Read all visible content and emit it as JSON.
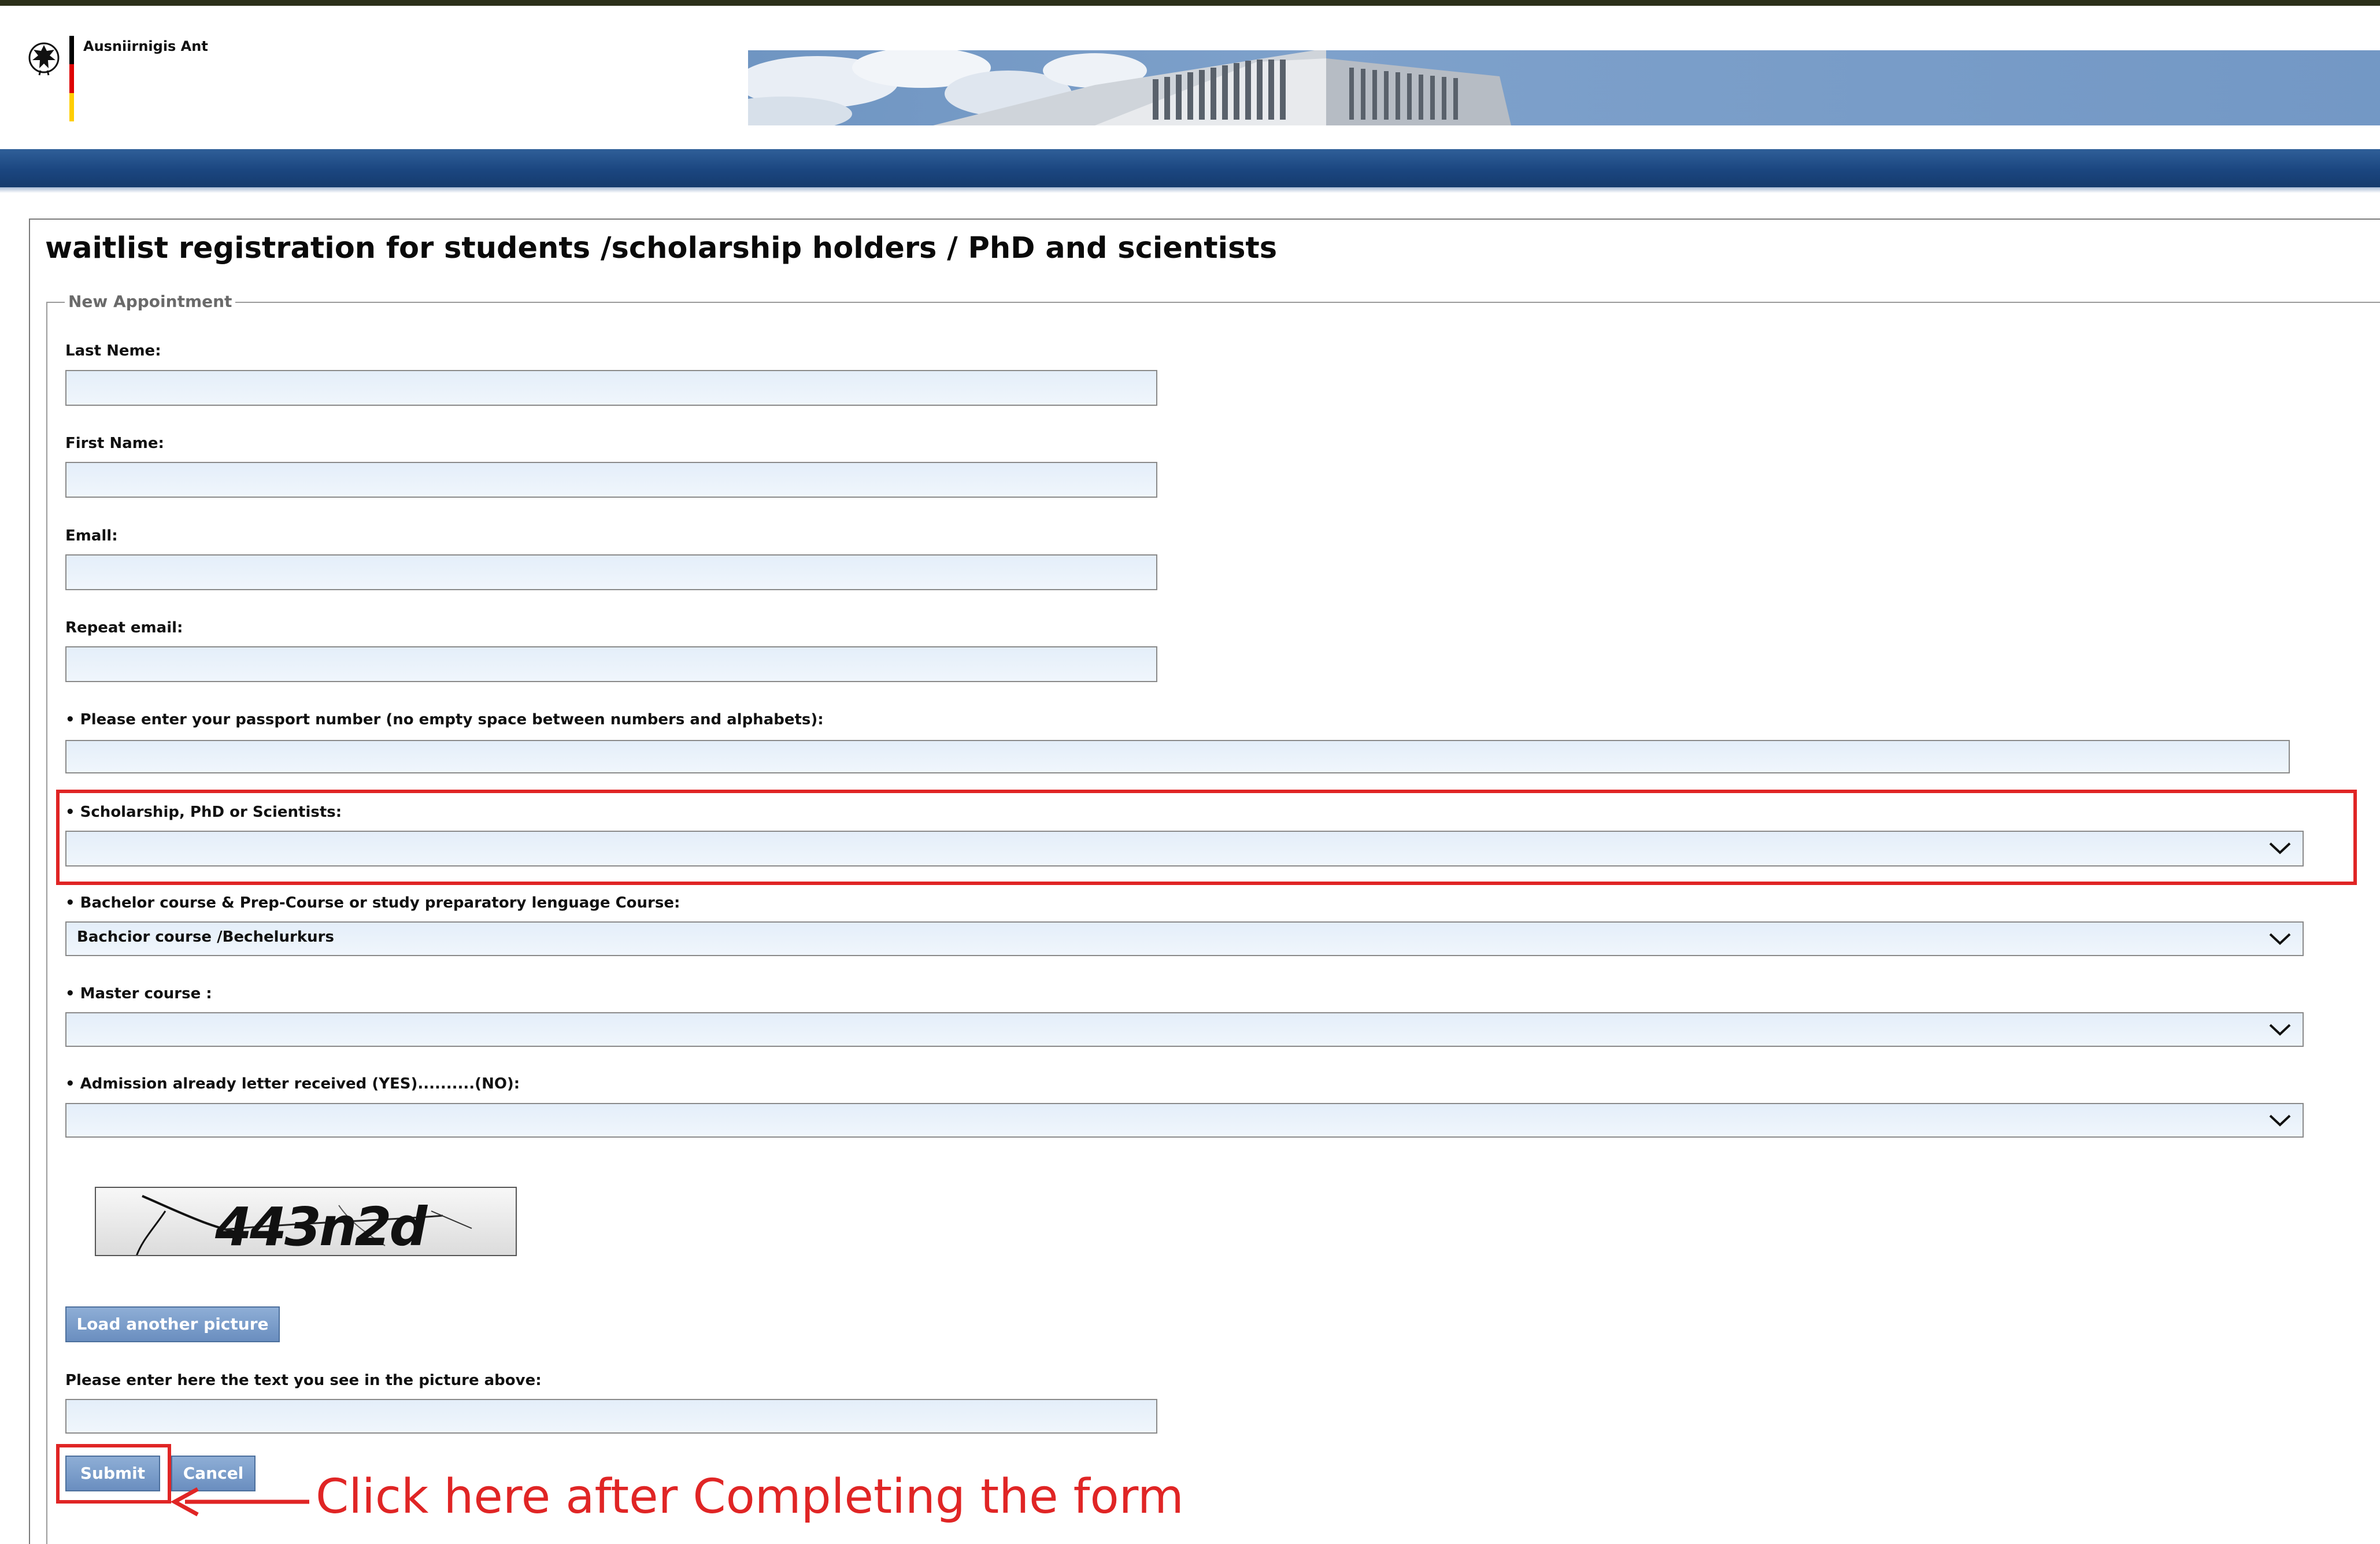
{
  "header": {
    "brand": "Ausniirnigis Ant",
    "flag_colors": [
      "#000000",
      "#dd0000",
      "#ffce00"
    ],
    "nav_color": "#1b4680"
  },
  "page": {
    "title": "waitlist registration for students /scholarship holders / PhD and scientists"
  },
  "form": {
    "legend": "New Appointment",
    "last_name_label": "Last Neme:",
    "first_name_label": "First Name:",
    "email_label": "Emall:",
    "repeat_email_label": "Repeat email:",
    "passport_label": "• Please enter your passport number (no empty space between numbers and alphabets):",
    "scholarship_label": "• Scholarship, PhD or Scientists:",
    "scholarship_value": "",
    "bachelor_label": "• Bachelor course & Prep-Course or study preparatory lenguage Course:",
    "bachelor_value": "Bachcior course /Bechelurkurs",
    "master_label": "• Master course :",
    "master_value": "",
    "admission_label": "• Admission already letter received (YES)..........(NO):",
    "admission_value": "",
    "captcha_text": "443n2d",
    "reload_button": "Load another picture",
    "captcha_input_label": "Please enter here the text you see in the picture above:",
    "submit_button": "Submit",
    "cancel_button": "Cancel"
  },
  "annotation": {
    "text": "Click here after Completing the form",
    "color": "#e02525"
  },
  "icons": {
    "logo": "federal-eagle-icon",
    "dropdown": "chevron-down-icon"
  }
}
